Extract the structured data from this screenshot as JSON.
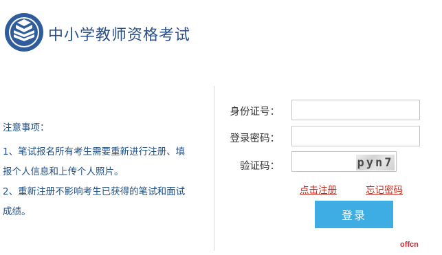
{
  "header": {
    "title": "中小学教师资格考试"
  },
  "notice": {
    "title": "注意事项：",
    "items": [
      "1、笔试报名所有考生需要重新进行注册、填",
      "报个人信息和上传个人照片。",
      "2、重新注册不影响考生已获得的笔试和面试",
      "成绩。"
    ]
  },
  "form": {
    "id_label": "身份证号：",
    "id_value": "",
    "password_label": "登录密码：",
    "password_value": "",
    "captcha_label": "验证码：",
    "captcha_value": "",
    "captcha_text": "pyn7",
    "register_link": "点击注册",
    "forgot_link": "忘记密码",
    "login_button": "登录"
  },
  "watermark": "offcn",
  "colors": {
    "brand": "#2a4f8a",
    "button": "#3dade4",
    "link": "#c02a1f",
    "watermark": "#d9242b"
  }
}
